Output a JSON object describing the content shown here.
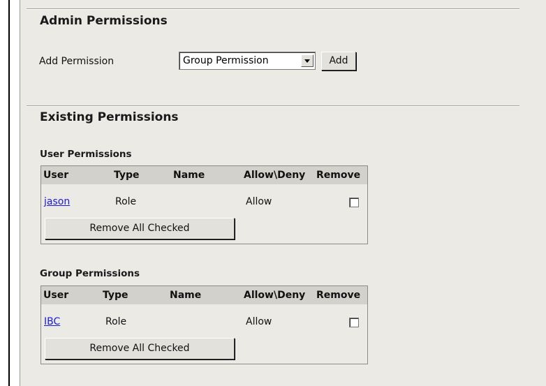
{
  "admin": {
    "title": "Admin Permissions",
    "add_label": "Add Permission",
    "select_value": "Group Permission",
    "add_button": "Add"
  },
  "existing": {
    "title": "Existing Permissions"
  },
  "user_permissions": {
    "title": "User Permissions",
    "columns": [
      "User",
      "Type",
      "Name",
      "Allow\\Deny",
      "Remove"
    ],
    "rows": [
      {
        "user": "jason",
        "type": "Role",
        "name": "",
        "allow": "Allow",
        "remove": false
      }
    ],
    "remove_all": "Remove All Checked"
  },
  "group_permissions": {
    "title": "Group Permissions",
    "columns": [
      "User",
      "Type",
      "Name",
      "Allow\\Deny",
      "Remove"
    ],
    "rows": [
      {
        "user": "IBC",
        "type": "Role",
        "name": "",
        "allow": "Allow",
        "remove": false
      }
    ],
    "remove_all": "Remove All Checked"
  },
  "icons": {
    "dropdown": "chevron-down-icon",
    "checkbox": "checkbox-icon"
  },
  "colors": {
    "panel_bg": "#eceae5",
    "table_header_bg": "#d3d1cb",
    "link": "#1a1ad9"
  }
}
